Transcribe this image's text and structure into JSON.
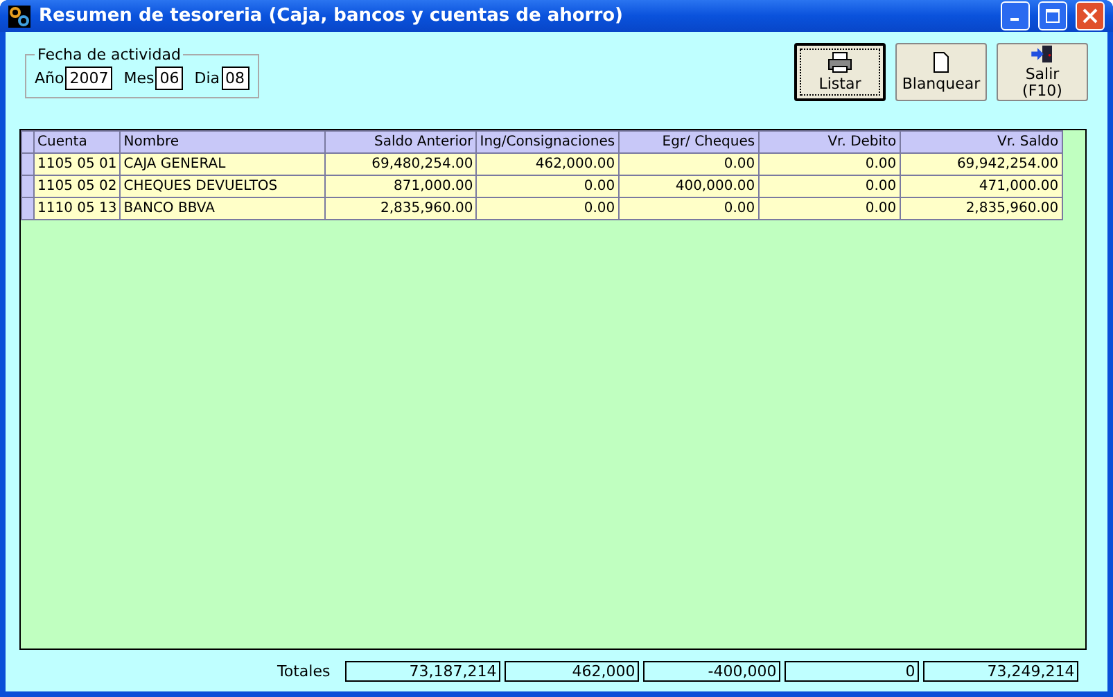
{
  "window": {
    "title": "Resumen de tesoreria (Caja, bancos y cuentas de ahorro)"
  },
  "date_group": {
    "legend": "Fecha de actividad",
    "fields": [
      {
        "label": "Año",
        "value": "2007"
      },
      {
        "label": "Mes",
        "value": "06"
      },
      {
        "label": "Dia",
        "value": "08"
      }
    ]
  },
  "buttons": [
    {
      "kind": "print",
      "label": "Listar",
      "selected": true
    },
    {
      "kind": "blank",
      "label": "Blanquear",
      "selected": false
    },
    {
      "kind": "exit",
      "label": "Salir (F10)",
      "selected": false
    }
  ],
  "table": {
    "columns": [
      "Cuenta",
      "Nombre",
      "Saldo Anterior",
      "Ing/Consignaciones",
      "Egr/ Cheques",
      "Vr. Debito",
      "Vr. Saldo"
    ],
    "rows": [
      [
        "1105 05 01",
        "CAJA GENERAL",
        "69,480,254.00",
        "462,000.00",
        "0.00",
        "0.00",
        "69,942,254.00"
      ],
      [
        "1105 05 02",
        "CHEQUES DEVUELTOS",
        "871,000.00",
        "0.00",
        "400,000.00",
        "0.00",
        "471,000.00"
      ],
      [
        "1110 05 13",
        "BANCO BBVA",
        "2,835,960.00",
        "0.00",
        "0.00",
        "0.00",
        "2,835,960.00"
      ]
    ]
  },
  "totals": {
    "label": "Totales",
    "values": [
      "73,187,214",
      "462,000",
      "-400,000",
      "0",
      "73,249,214"
    ]
  }
}
